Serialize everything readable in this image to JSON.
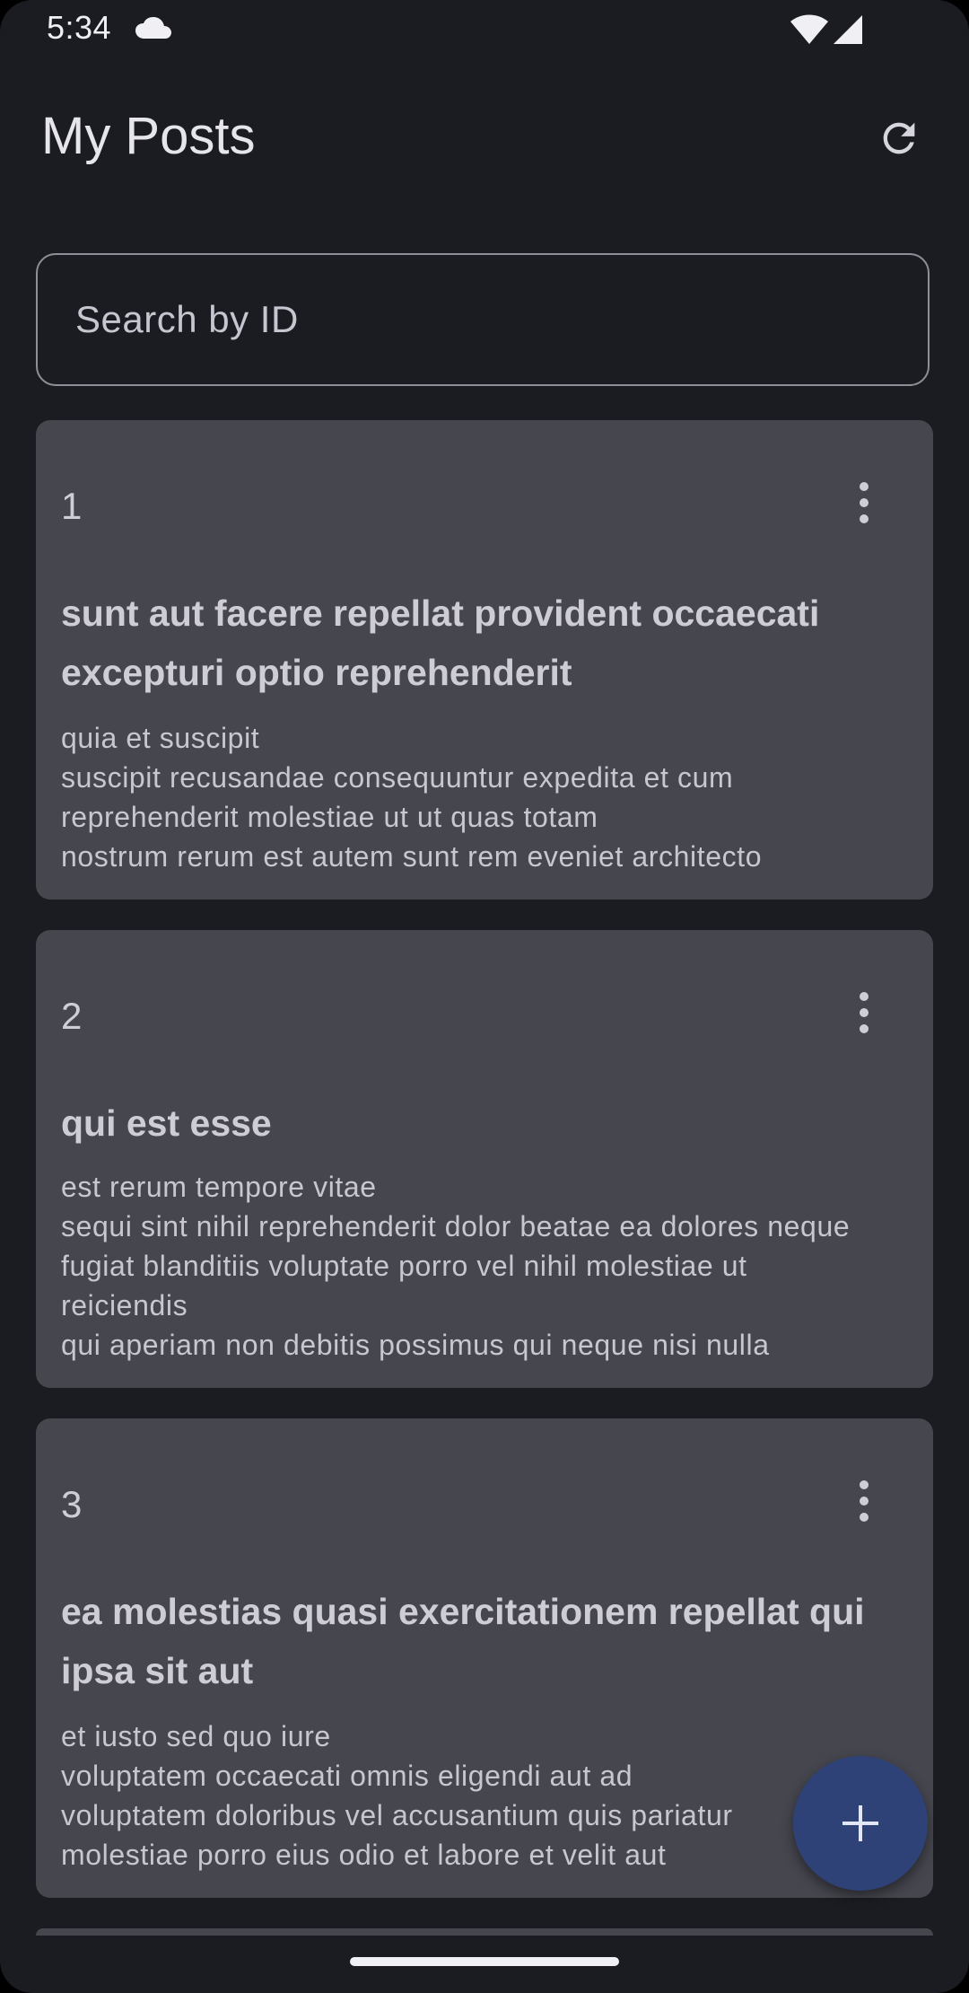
{
  "status_bar": {
    "time": "5:34",
    "icons": [
      "cloud-icon",
      "wifi-icon",
      "signal-icon"
    ]
  },
  "app_bar": {
    "title": "My Posts",
    "refresh_icon": "refresh-icon"
  },
  "search": {
    "placeholder": "Search by ID",
    "value": ""
  },
  "posts": [
    {
      "id": "1",
      "title": "sunt aut facere repellat provident occaecati excepturi optio reprehenderit",
      "body": "quia et suscipit\nsuscipit recusandae consequuntur expedita et cum\nreprehenderit molestiae ut ut quas totam\nnostrum rerum est autem sunt rem eveniet architecto"
    },
    {
      "id": "2",
      "title": "qui est esse",
      "body": "est rerum tempore vitae\nsequi sint nihil reprehenderit dolor beatae ea dolores neque\nfugiat blanditiis voluptate porro vel nihil molestiae ut\nreiciendis\nqui aperiam non debitis possimus qui neque nisi nulla"
    },
    {
      "id": "3",
      "title": "ea molestias quasi exercitationem repellat qui ipsa sit aut",
      "body": "et iusto sed quo iure\nvoluptatem occaecati omnis eligendi aut ad\nvoluptatem doloribus vel accusantium quis pariatur\nmolestiae porro eius odio et labore et velit aut"
    }
  ],
  "fab": {
    "icon": "plus-icon"
  },
  "colors": {
    "background": "#1b1c21",
    "card": "#46464f",
    "fab": "#2e4278",
    "outline": "#8e8e98"
  }
}
